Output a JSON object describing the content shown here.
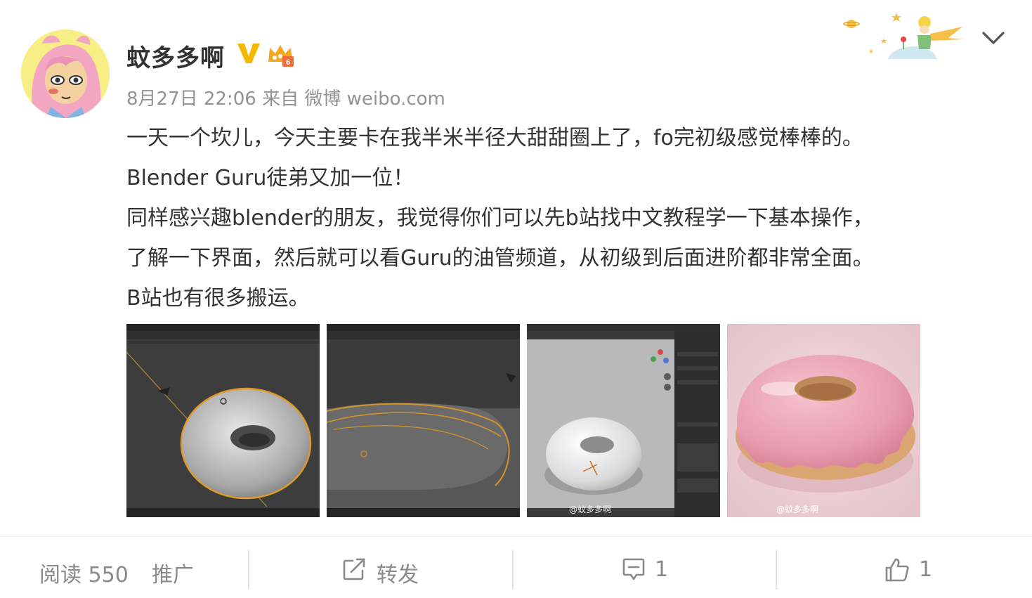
{
  "post": {
    "username": "蚊多多啊",
    "badge_verified": "V",
    "meta": "8月27日 22:06 来自 微博 weibo.com",
    "content_lines": [
      "一天一个坎儿，今天主要卡在我半米半径大甜甜圈上了，fo完初级感觉棒棒的。",
      "Blender Guru徒弟又加一位！",
      "同样感兴趣blender的朋友，我觉得你们可以先b站找中文教程学一下基本操作，",
      "了解一下界面，然后就可以看Guru的油管频道，从初级到后面进阶都非常全面。",
      "B站也有很多搬运。"
    ],
    "images": [
      {
        "name": "blender-viewport-donut-wireframe",
        "icon": "image-icon"
      },
      {
        "name": "blender-viewport-donut-side",
        "icon": "image-icon"
      },
      {
        "name": "blender-viewport-donut-props",
        "icon": "image-icon",
        "watermark": "@蚊多多啊"
      },
      {
        "name": "rendered-pink-donut",
        "icon": "image-icon",
        "watermark": "@蚊多多啊"
      }
    ]
  },
  "footer": {
    "reads": "阅读 550",
    "promote": "推广",
    "repost": "转发",
    "comments": "1",
    "likes": "1"
  },
  "colors": {
    "text": "#333333",
    "meta": "#939393",
    "footer_text": "#8a8a8a",
    "verified": "#f5b800",
    "donut_icing": "#e8a3b1"
  },
  "icons": {
    "verified": "verified-v-icon",
    "vip": "crown-icon",
    "dropdown": "chevron-down-icon",
    "repost": "repost-icon",
    "comment": "comment-icon",
    "like": "thumbs-up-icon"
  }
}
